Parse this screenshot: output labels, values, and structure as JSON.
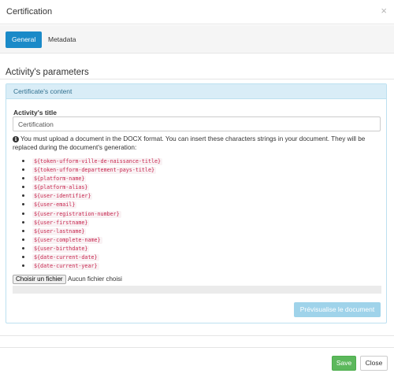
{
  "modal": {
    "title": "Certification",
    "close_glyph": "×"
  },
  "tabs": [
    {
      "label": "General",
      "active": true
    },
    {
      "label": "Metadata",
      "active": false
    }
  ],
  "section_title": "Activity's parameters",
  "panel": {
    "heading": "Certificate's content",
    "title_label": "Activity's title",
    "title_value": "Certification",
    "info_icon": "info-circle-icon",
    "info_text": "You must upload a document in the DOCX format. You can insert these characters strings in your document. They will be replaced during the document's generation:",
    "tokens": [
      "${token-ufform-ville-de-naissance-title}",
      "${token-ufform-departement-pays-title}",
      "${platform-name}",
      "${platform-alias}",
      "${user-identifier}",
      "${user-email}",
      "${user-registration-number}",
      "${user-firstname}",
      "${user-lastname}",
      "${user-complete-name}",
      "${user-birthdate}",
      "${date-current-date}",
      "${date-current-year}"
    ],
    "file_button": "Choisir un fichier",
    "file_status": "Aucun fichier choisi",
    "preview_button": "Prévisualise le document"
  },
  "footer": {
    "save_label": "Save",
    "close_label": "Close"
  },
  "colors": {
    "primary": "#1a8ac8",
    "panel_heading_bg": "#d9edf7",
    "token_text": "#c7254e",
    "save_green": "#5cb85c",
    "preview_disabled": "#9fd3ea"
  }
}
